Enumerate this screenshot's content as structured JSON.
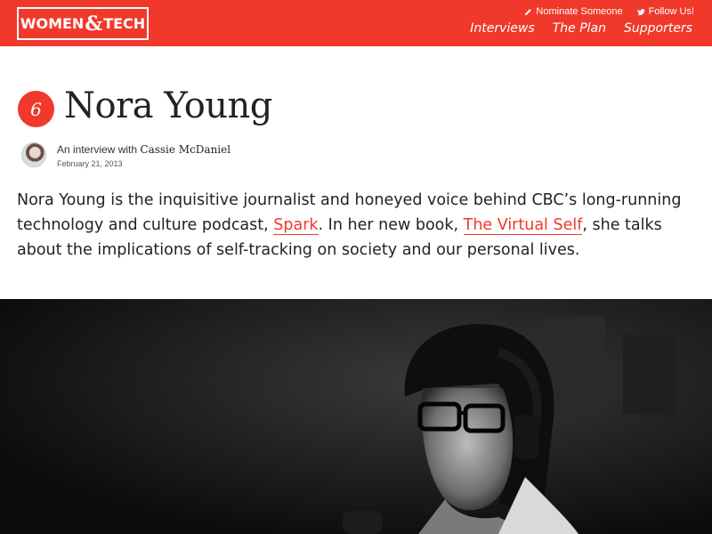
{
  "header": {
    "logo_left": "WOMEN",
    "logo_amp": "&",
    "logo_right": "TECH",
    "util": [
      {
        "label": "Nominate Someone",
        "icon": "pencil-icon"
      },
      {
        "label": "Follow Us!",
        "icon": "twitter-bird-icon"
      }
    ],
    "nav": [
      "Interviews",
      "The Plan",
      "Supporters"
    ]
  },
  "article": {
    "number": "6",
    "title": "Nora Young",
    "byline_prefix": "An interview with",
    "author": "Cassie McDaniel",
    "date": "February 21, 2013",
    "intro_1": "Nora Young is the inquisitive journalist and honeyed voice behind CBC’s long-running technology and culture podcast, ",
    "link_spark": "Spark",
    "intro_2": ". In her new book, ",
    "link_book": "The Virtual Self",
    "intro_3": ", she talks about the implications of self-tracking on society and our personal lives."
  },
  "colors": {
    "accent": "#f0392b",
    "text": "#222222",
    "photo_bg": "#111111"
  }
}
